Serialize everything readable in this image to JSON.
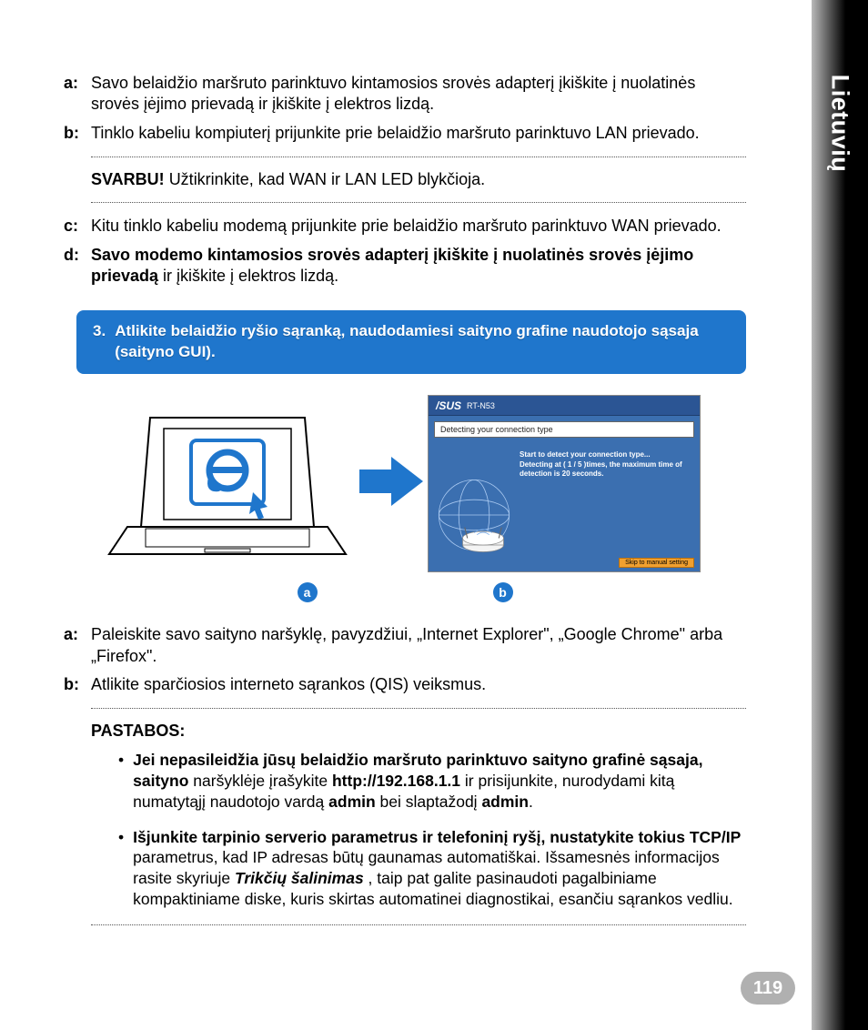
{
  "side_tab": "Lietuvių",
  "steps_top": {
    "a": "Savo belaidžio maršruto parinktuvo kintamosios srovės adapterį įkiškite į nuolatinės srovės įėjimo prievadą ir įkiškite į elektros lizdą.",
    "b": "Tinklo kabeliu kompiuterį prijunkite prie belaidžio maršruto parinktuvo LAN prievado."
  },
  "important_label": "SVARBU!",
  "important_text": "Užtikrinkite, kad WAN ir LAN LED blykčioja.",
  "steps_mid": {
    "c": "Kitu tinklo kabeliu modemą prijunkite prie belaidžio maršruto parinktuvo WAN prievado.",
    "d_bold": "Savo modemo kintamosios srovės adapterį įkiškite į nuolatinės srovės įėjimo prievadą",
    "d_tail": " ir įkiškite į elektros lizdą."
  },
  "callout": {
    "num": "3.",
    "text": "Atlikite belaidžio ryšio sąranką, naudodamiesi saityno grafine naudotojo sąsaja (saityno GUI)."
  },
  "gui": {
    "brand": "/SUS",
    "model": "RT-N53",
    "bar": "Detecting your connection type",
    "msg_line1": "Start to detect your connection type...",
    "msg_line2": "Detecting at ( 1 / 5 )times, the maximum time of detection is 20 seconds.",
    "footer": "Skip to manual setting"
  },
  "badges": {
    "a": "a",
    "b": "b"
  },
  "steps_bottom": {
    "a": "Paleiskite savo saityno naršyklę, pavyzdžiui, „Internet Explorer\", „Google Chrome\" arba „Firefox\".",
    "b": "Atlikite sparčiosios interneto sąrankos (QIS) veiksmus."
  },
  "notes_title": "PASTABOS:",
  "notes": {
    "n1_lead": "Jei nepasileidžia jūsų belaidžio maršruto parinktuvo saityno grafinė sąsaja, saityno",
    "n1_mid1": " naršyklėje įrašykite ",
    "n1_url": "http://192.168.1.1",
    "n1_mid2": " ir prisijunkite, nurodydami kitą numatytąjį naudotojo vardą ",
    "n1_admin1": "admin",
    "n1_mid3": " bei slaptažodį ",
    "n1_admin2": "admin",
    "n1_tail": ".",
    "n2_lead": "Išjunkite tarpinio serverio parametrus ir telefoninį ryšį, nustatykite tokius TCP/IP",
    "n2_mid1": " parametrus, kad IP adresas būtų gaunamas automatiškai. Išsamesnės informacijos rasite skyriuje ",
    "n2_em": "Trikčių šalinimas",
    "n2_tail": " , taip pat galite pasinaudoti pagalbiniame kompaktiniame diske, kuris skirtas automatinei diagnostikai, esančiu sąrankos vedliu."
  },
  "page_number": "119"
}
